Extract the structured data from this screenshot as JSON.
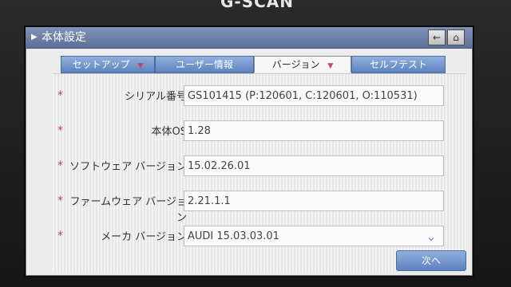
{
  "brand": {
    "text": "G-SCAN"
  },
  "window": {
    "title": "本体設定",
    "title_icon": "triangle-right-icon",
    "back_icon": "back-arrow-icon",
    "home_icon": "home-icon"
  },
  "tabs": [
    {
      "label": "セットアップ",
      "active": false
    },
    {
      "label": "ユーザー情報",
      "active": false
    },
    {
      "label": "バージョン",
      "active": true
    },
    {
      "label": "セルフテスト",
      "active": false
    }
  ],
  "rows": [
    {
      "label": "シリアル番号",
      "value": "GS101415 (P:120601, C:120601, O:110531)"
    },
    {
      "label": "本体OS",
      "value": "1.28"
    },
    {
      "label": "ソフトウェア バージョン",
      "value": "15.02.26.01"
    },
    {
      "label": "ファームウェア バージョン",
      "value": "2.21.1.1"
    },
    {
      "label": "メーカ バージョン",
      "value": "AUDI 15.03.03.01",
      "has_dropdown": true
    }
  ],
  "buttons": {
    "next": "次へ"
  },
  "colors": {
    "titlebar": "#6b7fa8",
    "tab": "#6c8fc8",
    "required_mark": "#c53d58"
  }
}
